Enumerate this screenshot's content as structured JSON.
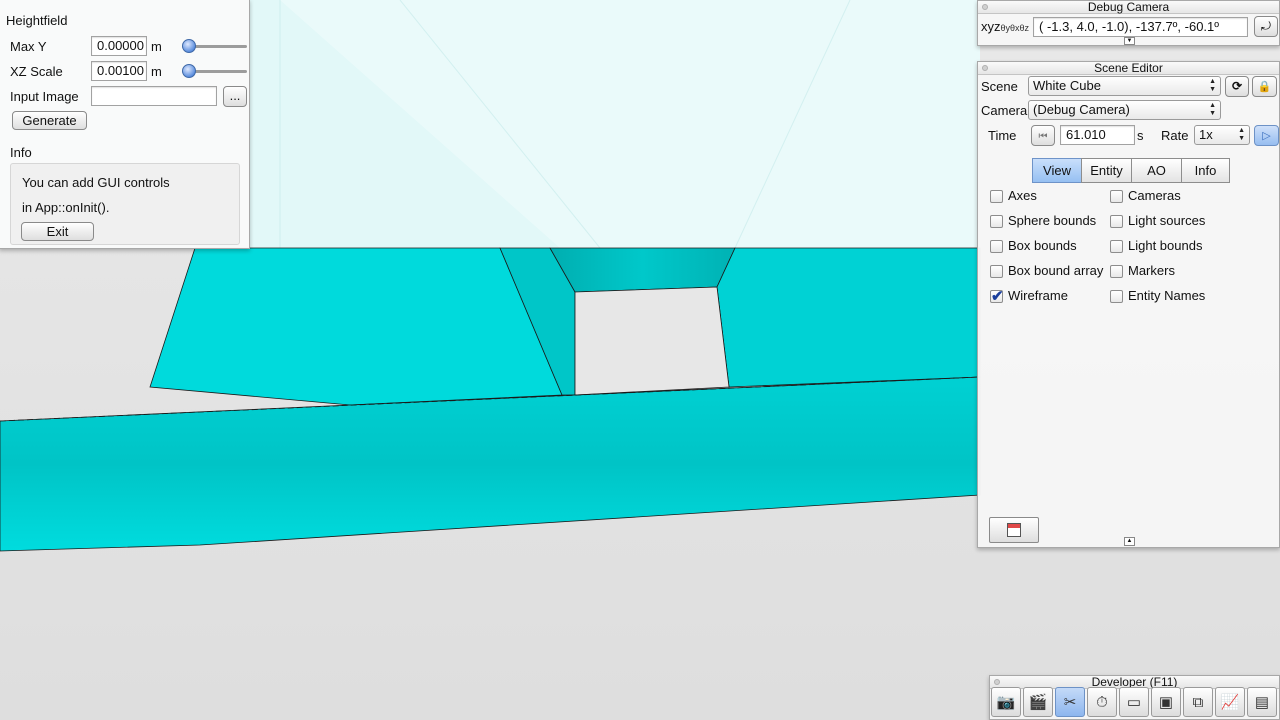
{
  "heightfield": {
    "title": "Heightfield",
    "max_y": {
      "label": "Max Y",
      "value": "0.00000",
      "unit": "m",
      "slider_fraction": 0.05
    },
    "xz_scale": {
      "label": "XZ Scale",
      "value": "0.00100",
      "unit": "m",
      "slider_fraction": 0.05
    },
    "input_image": {
      "label": "Input Image",
      "value": "",
      "browse_label": "..."
    },
    "generate_label": "Generate",
    "info": {
      "heading": "Info",
      "line1": "You can add GUI controls",
      "line2": "in App::onInit().",
      "exit_label": "Exit"
    }
  },
  "debug_camera": {
    "title": "Debug Camera",
    "xyz_label": "xyz",
    "xyz_sub": "θyθxθz",
    "coords": "( -1.3,   4.0,  -1.0), -137.7º, -60.1º"
  },
  "scene_editor": {
    "title": "Scene Editor",
    "scene_label": "Scene",
    "scene_value": "White Cube",
    "camera_label": "Camera",
    "camera_value": "(Debug Camera)",
    "time_label": "Time",
    "time_value": "61.010",
    "time_unit": "s",
    "rate_label": "Rate",
    "rate_value": "1x",
    "tabs": [
      "View",
      "Entity",
      "AO",
      "Info"
    ],
    "active_tab": "View",
    "checkboxes_left": [
      {
        "label": "Axes",
        "checked": false
      },
      {
        "label": "Sphere bounds",
        "checked": false
      },
      {
        "label": "Box bounds",
        "checked": false
      },
      {
        "label": "Box bound array",
        "checked": false
      },
      {
        "label": "Wireframe",
        "checked": true
      }
    ],
    "checkboxes_right": [
      {
        "label": "Cameras",
        "checked": false
      },
      {
        "label": "Light sources",
        "checked": false
      },
      {
        "label": "Light bounds",
        "checked": false
      },
      {
        "label": "Markers",
        "checked": false
      },
      {
        "label": "Entity Names",
        "checked": false
      }
    ]
  },
  "developer": {
    "title": "Developer (F11)",
    "icons": [
      "camera-icon",
      "clapperboard-icon",
      "tools-icon",
      "stopwatch-icon",
      "new-window-icon",
      "console-icon",
      "windows-icon",
      "profiler-icon",
      "document-icon"
    ],
    "active_icon": "tools-icon"
  },
  "colors": {
    "cyan": "#00d7d9",
    "sky": "#e2f8f8",
    "accent_blue": "#96c0f2"
  }
}
